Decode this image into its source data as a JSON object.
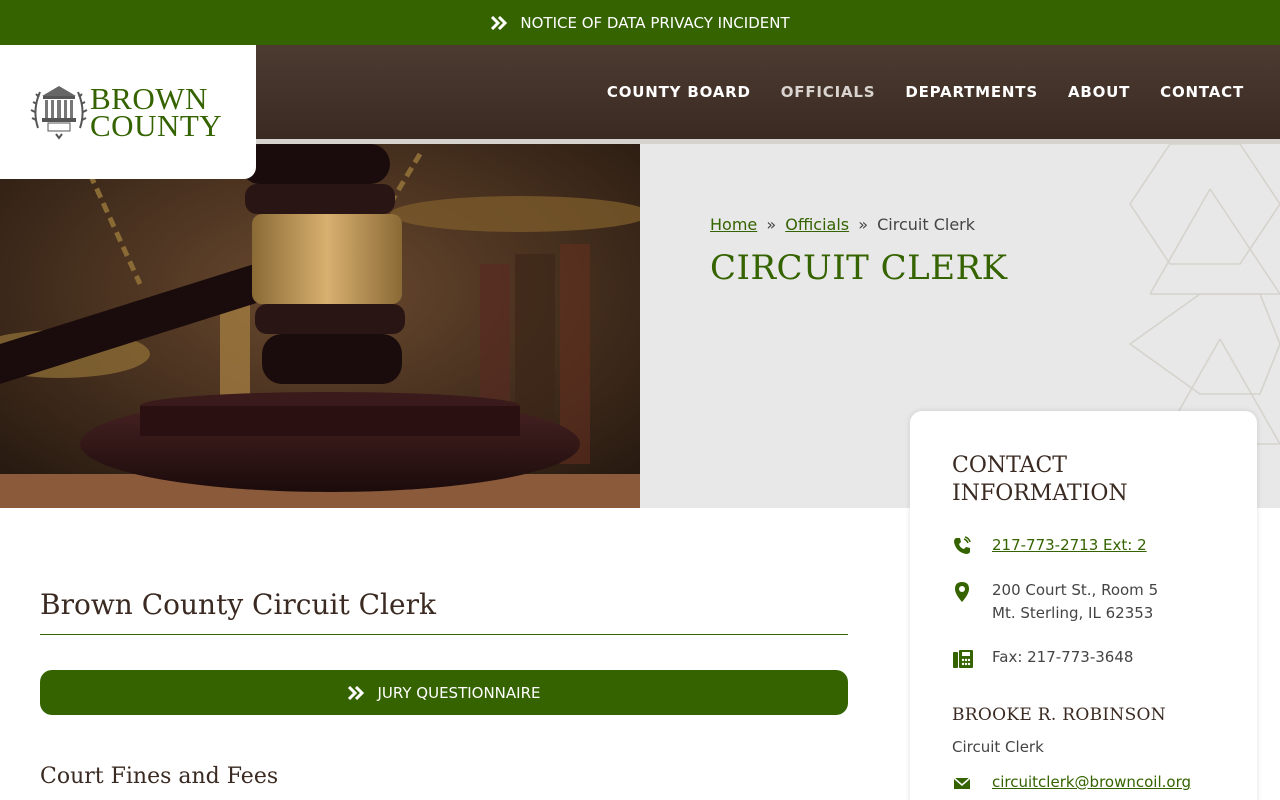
{
  "alert": {
    "label": "NOTICE OF DATA PRIVACY INCIDENT",
    "icon": "double-chevron-right-icon"
  },
  "logo": {
    "line1": "BROWN",
    "line2": "COUNTY",
    "icon": "courthouse-seal-icon"
  },
  "nav": {
    "items": [
      {
        "label": "COUNTY BOARD"
      },
      {
        "label": "OFFICIALS"
      },
      {
        "label": "DEPARTMENTS"
      },
      {
        "label": "ABOUT"
      },
      {
        "label": "CONTACT"
      }
    ]
  },
  "breadcrumb": {
    "home": "Home",
    "sep": "»",
    "officials": "Officials",
    "current": "Circuit Clerk"
  },
  "page": {
    "title": "CIRCUIT CLERK",
    "heading": "Brown County Circuit Clerk",
    "subheading": "Court Fines and Fees"
  },
  "jury_button": {
    "label": "JURY QUESTIONNAIRE",
    "icon": "double-chevron-right-icon"
  },
  "contact": {
    "title": "CONTACT INFORMATION",
    "phone": "217-773-2713 Ext: 2",
    "address_line1": "200 Court St., Room 5",
    "address_line2": "Mt. Sterling, IL 62353",
    "fax": "Fax: 217-773-3648",
    "official_name": "BROOKE R. ROBINSON",
    "official_role": "Circuit Clerk",
    "email": "circuitclerk@browncoil.org"
  },
  "colors": {
    "brand_green": "#346300",
    "header_brown": "#3a2a21",
    "hero_gray": "#e8e8e8"
  }
}
